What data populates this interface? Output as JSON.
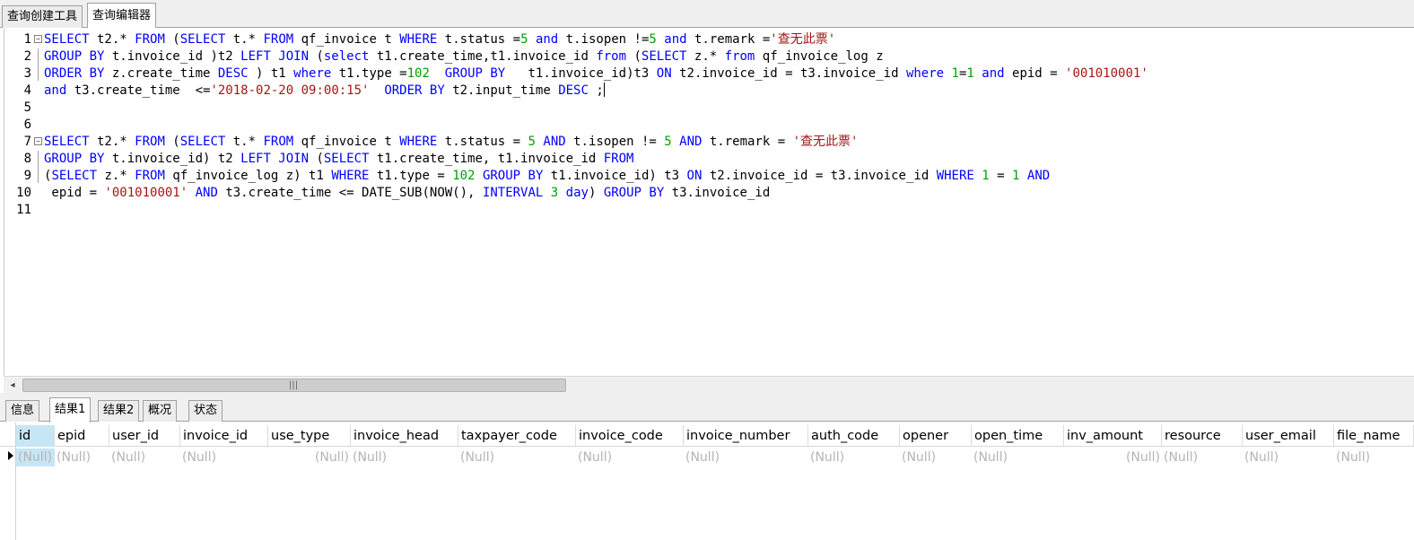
{
  "top_tabs": [
    "查询创建工具",
    "查询编辑器"
  ],
  "editor": {
    "lines": [
      {
        "n": "1",
        "tokens": [
          [
            "kw",
            "SELECT"
          ],
          [
            "p",
            " t2.* "
          ],
          [
            "kw",
            "FROM"
          ],
          [
            "p",
            " ("
          ],
          [
            "kw",
            "SELECT"
          ],
          [
            "p",
            " t.* "
          ],
          [
            "kw",
            "FROM"
          ],
          [
            "p",
            " qf_invoice t "
          ],
          [
            "kw",
            "WHERE"
          ],
          [
            "p",
            " t.status ="
          ],
          [
            "num",
            "5"
          ],
          [
            "p",
            " "
          ],
          [
            "kw",
            "and"
          ],
          [
            "p",
            " t.isopen !="
          ],
          [
            "num",
            "5"
          ],
          [
            "p",
            " "
          ],
          [
            "kw",
            "and"
          ],
          [
            "p",
            " t.remark ="
          ],
          [
            "str",
            "'查无此票'"
          ]
        ]
      },
      {
        "n": "2",
        "tokens": [
          [
            "kw",
            "GROUP BY"
          ],
          [
            "p",
            " t.invoice_id )t2 "
          ],
          [
            "kw",
            "LEFT JOIN"
          ],
          [
            "p",
            " ("
          ],
          [
            "kw",
            "select"
          ],
          [
            "p",
            " t1.create_time,t1.invoice_id "
          ],
          [
            "kw",
            "from"
          ],
          [
            "p",
            " ("
          ],
          [
            "kw",
            "SELECT"
          ],
          [
            "p",
            " z.* "
          ],
          [
            "kw",
            "from"
          ],
          [
            "p",
            " qf_invoice_log z"
          ]
        ]
      },
      {
        "n": "3",
        "tokens": [
          [
            "kw",
            "ORDER BY"
          ],
          [
            "p",
            " z.create_time "
          ],
          [
            "kw",
            "DESC"
          ],
          [
            "p",
            " ) t1 "
          ],
          [
            "kw",
            "where"
          ],
          [
            "p",
            " t1.type ="
          ],
          [
            "num",
            "102"
          ],
          [
            "p",
            "  "
          ],
          [
            "kw",
            "GROUP BY"
          ],
          [
            "p",
            "   t1.invoice_id)t3 "
          ],
          [
            "kw",
            "ON"
          ],
          [
            "p",
            " t2.invoice_id = t3.invoice_id "
          ],
          [
            "kw",
            "where"
          ],
          [
            "p",
            " "
          ],
          [
            "num",
            "1"
          ],
          [
            "p",
            "="
          ],
          [
            "num",
            "1"
          ],
          [
            "p",
            " "
          ],
          [
            "kw",
            "and"
          ],
          [
            "p",
            " epid = "
          ],
          [
            "str",
            "'001010001'"
          ]
        ]
      },
      {
        "n": "4",
        "tokens": [
          [
            "kw",
            "and"
          ],
          [
            "p",
            " t3.create_time  <="
          ],
          [
            "str",
            "'2018-02-20 09:00:15'"
          ],
          [
            "p",
            "  "
          ],
          [
            "kw",
            "ORDER BY"
          ],
          [
            "p",
            " t2.input_time "
          ],
          [
            "kw",
            "DESC"
          ],
          [
            "p",
            " ;"
          ]
        ]
      },
      {
        "n": "5",
        "tokens": []
      },
      {
        "n": "6",
        "tokens": []
      },
      {
        "n": "7",
        "tokens": [
          [
            "kw",
            "SELECT"
          ],
          [
            "p",
            " t2.* "
          ],
          [
            "kw",
            "FROM"
          ],
          [
            "p",
            " ("
          ],
          [
            "kw",
            "SELECT"
          ],
          [
            "p",
            " t.* "
          ],
          [
            "kw",
            "FROM"
          ],
          [
            "p",
            " qf_invoice t "
          ],
          [
            "kw",
            "WHERE"
          ],
          [
            "p",
            " t.status = "
          ],
          [
            "num",
            "5"
          ],
          [
            "p",
            " "
          ],
          [
            "kw",
            "AND"
          ],
          [
            "p",
            " t.isopen != "
          ],
          [
            "num",
            "5"
          ],
          [
            "p",
            " "
          ],
          [
            "kw",
            "AND"
          ],
          [
            "p",
            " t.remark = "
          ],
          [
            "str",
            "'查无此票'"
          ]
        ]
      },
      {
        "n": "8",
        "tokens": [
          [
            "kw",
            "GROUP BY"
          ],
          [
            "p",
            " t.invoice_id) t2 "
          ],
          [
            "kw",
            "LEFT JOIN"
          ],
          [
            "p",
            " ("
          ],
          [
            "kw",
            "SELECT"
          ],
          [
            "p",
            " t1.create_time, t1.invoice_id "
          ],
          [
            "kw",
            "FROM"
          ]
        ]
      },
      {
        "n": "9",
        "tokens": [
          [
            "p",
            "("
          ],
          [
            "kw",
            "SELECT"
          ],
          [
            "p",
            " z.* "
          ],
          [
            "kw",
            "FROM"
          ],
          [
            "p",
            " qf_invoice_log z) t1 "
          ],
          [
            "kw",
            "WHERE"
          ],
          [
            "p",
            " t1.type = "
          ],
          [
            "num",
            "102"
          ],
          [
            "p",
            " "
          ],
          [
            "kw",
            "GROUP BY"
          ],
          [
            "p",
            " t1.invoice_id) t3 "
          ],
          [
            "kw",
            "ON"
          ],
          [
            "p",
            " t2.invoice_id = t3.invoice_id "
          ],
          [
            "kw",
            "WHERE"
          ],
          [
            "p",
            " "
          ],
          [
            "num",
            "1"
          ],
          [
            "p",
            " = "
          ],
          [
            "num",
            "1"
          ],
          [
            "p",
            " "
          ],
          [
            "kw",
            "AND"
          ]
        ]
      },
      {
        "n": "10",
        "tokens": [
          [
            "p",
            " epid = "
          ],
          [
            "str",
            "'001010001'"
          ],
          [
            "p",
            " "
          ],
          [
            "kw",
            "AND"
          ],
          [
            "p",
            " t3.create_time <= DATE_SUB(NOW(), "
          ],
          [
            "kw",
            "INTERVAL"
          ],
          [
            "p",
            " "
          ],
          [
            "num",
            "3"
          ],
          [
            "p",
            " "
          ],
          [
            "kw",
            "day"
          ],
          [
            "p",
            ") "
          ],
          [
            "kw",
            "GROUP BY"
          ],
          [
            "p",
            " t3.invoice_id"
          ]
        ]
      },
      {
        "n": "11",
        "tokens": []
      }
    ]
  },
  "scrollbar": {
    "grip": "|||",
    "left_arrow": "◂"
  },
  "result_tabs": [
    "信息",
    "结果1",
    "结果2",
    "概况",
    "状态"
  ],
  "grid": {
    "columns": [
      "id",
      "epid",
      "user_id",
      "invoice_id",
      "use_type",
      "invoice_head",
      "taxpayer_code",
      "invoice_code",
      "invoice_number",
      "auth_code",
      "opener",
      "open_time",
      "inv_amount",
      "resource",
      "user_email",
      "file_name"
    ],
    "row": [
      "(Null)",
      "(Null)",
      "(Null)",
      "(Null)",
      "(Null)",
      "(Null)",
      "(Null)",
      "(Null)",
      "(Null)",
      "(Null)",
      "(Null)",
      "(Null)",
      "(Null)",
      "(Null)",
      "(Null)",
      "(Null)"
    ]
  },
  "colors": {
    "keyword": "#0000ff",
    "number": "#00a000",
    "string": "#a31515",
    "null_text": "#b4b4b4",
    "selection": "#c7e6f5"
  }
}
